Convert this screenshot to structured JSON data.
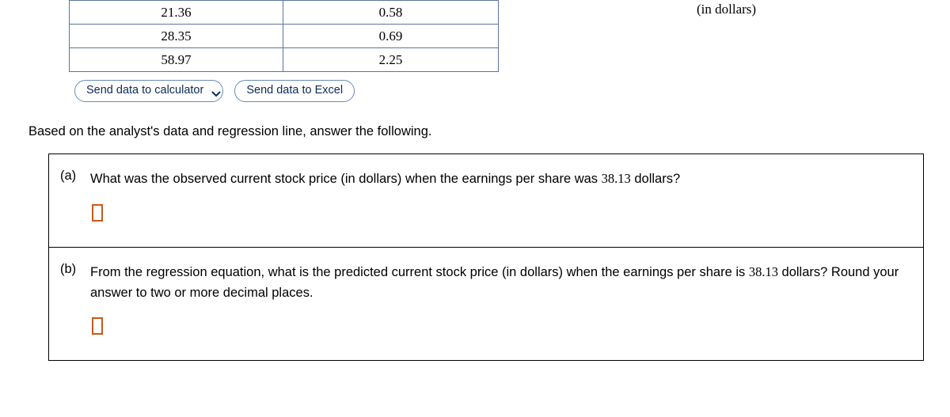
{
  "top_text": "(in dollars)",
  "table": {
    "rows": [
      {
        "c1": "21.36",
        "c2": "0.58"
      },
      {
        "c1": "28.35",
        "c2": "0.69"
      },
      {
        "c1": "58.97",
        "c2": "2.25"
      }
    ]
  },
  "buttons": {
    "send_calc": "Send data to calculator",
    "send_excel": "Send data to Excel"
  },
  "instruction": "Based on the analyst's data and regression line, answer the following.",
  "questions": {
    "a": {
      "label": "(a)",
      "pre": "What was the observed current stock price (in dollars) when the earnings per share was ",
      "num": "38.13",
      "post": " dollars?"
    },
    "b": {
      "label": "(b)",
      "pre": "From the regression equation, what is the predicted current stock price (in dollars) when the earnings per share is ",
      "num": "38.13",
      "post": " dollars? Round your answer to two or more decimal places."
    }
  }
}
